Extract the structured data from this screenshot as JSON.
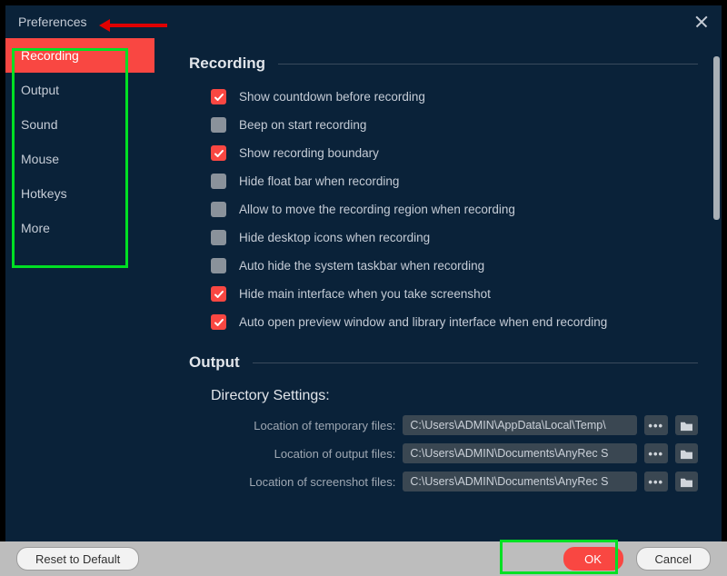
{
  "titlebar": {
    "title": "Preferences"
  },
  "sidebar": {
    "items": [
      {
        "label": "Recording",
        "active": true
      },
      {
        "label": "Output"
      },
      {
        "label": "Sound"
      },
      {
        "label": "Mouse"
      },
      {
        "label": "Hotkeys"
      },
      {
        "label": "More"
      }
    ]
  },
  "main": {
    "sections": {
      "recording": {
        "title": "Recording",
        "options": [
          {
            "label": "Show countdown before recording",
            "checked": true
          },
          {
            "label": "Beep on start recording",
            "checked": false
          },
          {
            "label": "Show recording boundary",
            "checked": true
          },
          {
            "label": "Hide float bar when recording",
            "checked": false
          },
          {
            "label": "Allow to move the recording region when recording",
            "checked": false
          },
          {
            "label": "Hide desktop icons when recording",
            "checked": false
          },
          {
            "label": "Auto hide the system taskbar when recording",
            "checked": false
          },
          {
            "label": "Hide main interface when you take screenshot",
            "checked": true
          },
          {
            "label": "Auto open preview window and library interface when end recording",
            "checked": true
          }
        ]
      },
      "output": {
        "title": "Output",
        "directory_heading": "Directory Settings:",
        "rows": [
          {
            "label": "Location of temporary files:",
            "value": "C:\\Users\\ADMIN\\AppData\\Local\\Temp\\"
          },
          {
            "label": "Location of output files:",
            "value": "C:\\Users\\ADMIN\\Documents\\AnyRec S"
          },
          {
            "label": "Location of screenshot files:",
            "value": "C:\\Users\\ADMIN\\Documents\\AnyRec S"
          }
        ]
      }
    }
  },
  "footer": {
    "reset": "Reset to Default",
    "ok": "OK",
    "cancel": "Cancel"
  },
  "colors": {
    "accent": "#F94742",
    "highlight": "#00E024",
    "background": "#0A2239"
  }
}
